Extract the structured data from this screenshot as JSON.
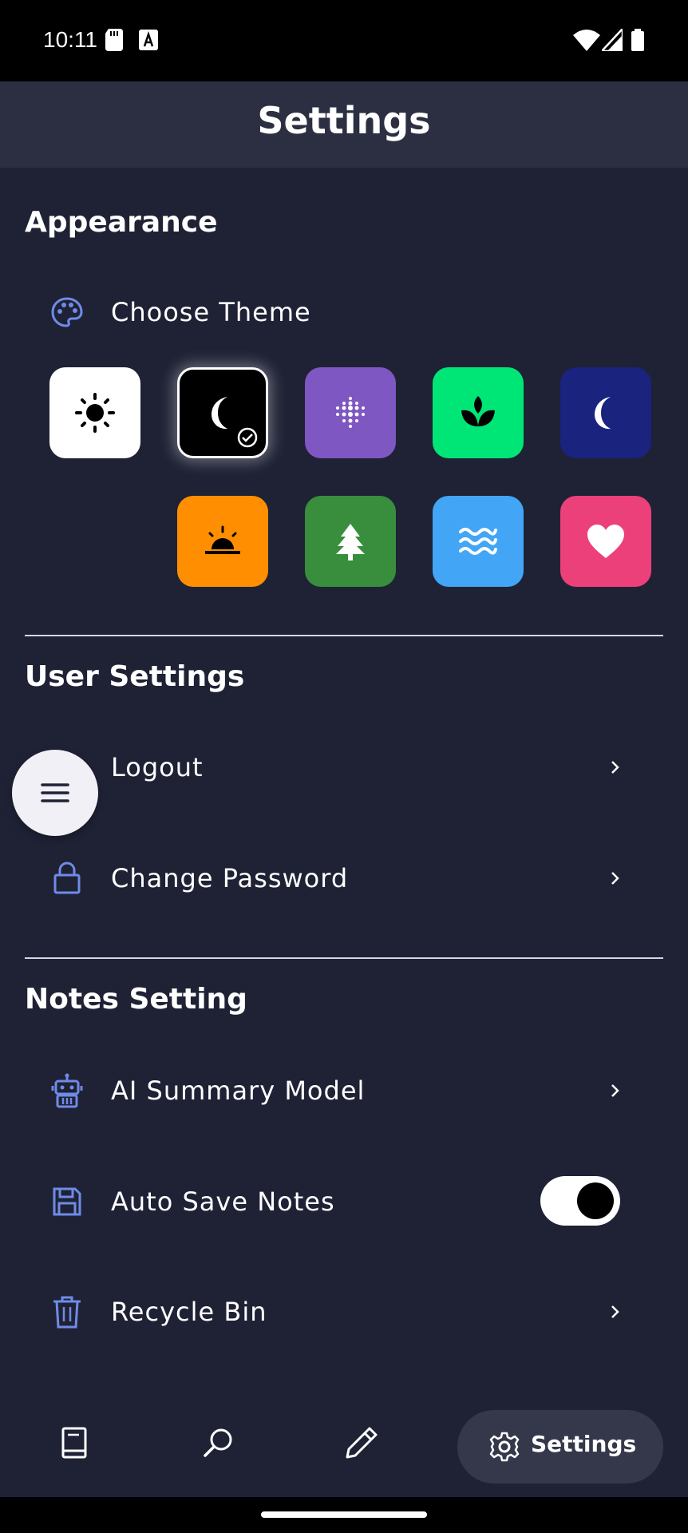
{
  "status_bar": {
    "time": "10:11"
  },
  "header": {
    "title": "Settings"
  },
  "appearance": {
    "section_title": "Appearance",
    "choose_theme_label": "Choose Theme",
    "themes": [
      {
        "name": "light",
        "icon": "sun-icon",
        "color": "#ffffff",
        "selected": false
      },
      {
        "name": "dark",
        "icon": "moon-icon",
        "color": "#000000",
        "selected": true
      },
      {
        "name": "purple",
        "icon": "dots-icon",
        "color": "#7e57c2",
        "selected": false
      },
      {
        "name": "green",
        "icon": "leaf-icon",
        "color": "#00e676",
        "selected": false
      },
      {
        "name": "navy",
        "icon": "moon-icon",
        "color": "#1a237e",
        "selected": false
      },
      {
        "name": "orange",
        "icon": "sunset-icon",
        "color": "#ff8f00",
        "selected": false
      },
      {
        "name": "forest",
        "icon": "tree-icon",
        "color": "#388e3c",
        "selected": false
      },
      {
        "name": "ocean",
        "icon": "waves-icon",
        "color": "#42a5f5",
        "selected": false
      },
      {
        "name": "pink",
        "icon": "heart-icon",
        "color": "#ec407a",
        "selected": false
      }
    ]
  },
  "user_settings": {
    "section_title": "User Settings",
    "logout_label": "Logout",
    "change_password_label": "Change Password"
  },
  "notes_setting": {
    "section_title": "Notes Setting",
    "ai_summary_label": "AI Summary Model",
    "auto_save_label": "Auto Save Notes",
    "auto_save_enabled": true,
    "recycle_bin_label": "Recycle Bin"
  },
  "bottom_nav": {
    "items": [
      "notes",
      "search",
      "edit",
      "settings"
    ],
    "active_label": "Settings"
  },
  "colors": {
    "background": "#1f2235",
    "header": "#2c2f41",
    "icon_accent": "#6f8be8",
    "nav_active": "#35384a"
  }
}
